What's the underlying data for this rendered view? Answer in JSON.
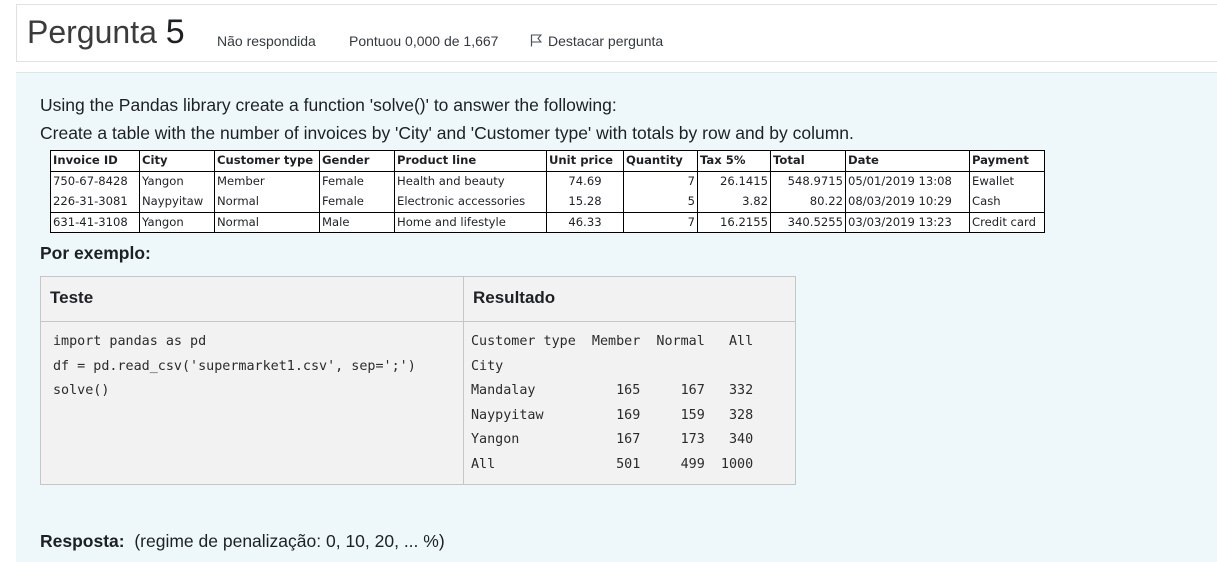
{
  "header": {
    "title": "Pergunta",
    "number": "5",
    "status": "Não respondida",
    "score": "Pontuou 0,000 de 1,667",
    "flag_label": "Destacar pergunta"
  },
  "question": {
    "line1": "Using the Pandas library create a function 'solve()' to answer the following:",
    "line2": "Create a table with the number of invoices by 'City' and 'Customer type' with totals by row and by column."
  },
  "data_table": {
    "headers": [
      "Invoice ID",
      "City",
      "Customer type",
      "Gender",
      "Product line",
      "Unit price",
      "Quantity",
      "Tax 5%",
      "Total",
      "Date",
      "Payment"
    ],
    "rows": [
      [
        "750-67-8428",
        "Yangon",
        "Member",
        "Female",
        "Health and beauty",
        "74.69",
        "7",
        "26.1415",
        "548.9715",
        "05/01/2019 13:08",
        "Ewallet"
      ],
      [
        "226-31-3081",
        "Naypyitaw",
        "Normal",
        "Female",
        "Electronic accessories",
        "15.28",
        "5",
        "3.82",
        "80.22",
        "08/03/2019 10:29",
        "Cash"
      ],
      [
        "631-41-3108",
        "Yangon",
        "Normal",
        "Male",
        "Home and lifestyle",
        "46.33",
        "7",
        "16.2155",
        "340.5255",
        "03/03/2019 13:23",
        "Credit card"
      ]
    ]
  },
  "example": {
    "label": "Por exemplo:",
    "col_test": "Teste",
    "col_result": "Resultado",
    "test_code": "import pandas as pd\ndf = pd.read_csv('supermarket1.csv', sep=';')\nsolve()",
    "result_output": "Customer type  Member  Normal   All\nCity                              \nMandalay          165     167   332\nNaypyitaw         169     159   328\nYangon            167     173   340\nAll               501     499  1000"
  },
  "answer": {
    "label": "Resposta:",
    "penalty": "(regime de penalização: 0, 10, 20, ... %)"
  }
}
